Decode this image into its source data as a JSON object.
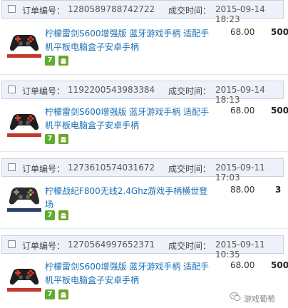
{
  "labels": {
    "order_no": "订单编号：",
    "deal_time": "成交时间："
  },
  "orders": [
    {
      "order_no": "1280589788742722",
      "time": "2015-09-14 18:23",
      "title": "柠檬雷剑S600增强版 蓝牙游戏手柄 适配手机平板电脑盒子安卓手柄",
      "price": "68.00",
      "qty": "500",
      "badge": "7"
    },
    {
      "order_no": "1192200543983384",
      "time": "2015-09-14 18:13",
      "title": "柠檬雷剑S600增强版 蓝牙游戏手柄 适配手机平板电脑盒子安卓手柄",
      "price": "68.00",
      "qty": "500",
      "badge": "7"
    },
    {
      "order_no": "1273610574031672",
      "time": "2015-09-11 17:03",
      "title": "柠檬战纪F800无线2.4Ghz游戏手柄横世登场",
      "price": "88.00",
      "qty": "3",
      "badge": "7"
    },
    {
      "order_no": "1270564997652371",
      "time": "2015-09-11 10:35",
      "title": "柠檬雷剑S600增强版 蓝牙游戏手柄 适配手机平板电脑盒子安卓手柄",
      "price": "68.00",
      "qty": "500",
      "badge": "7"
    }
  ],
  "watermark": "游戏葡萄",
  "colors": {
    "link": "#1a6fb3",
    "header_bg": "#eef2f8",
    "badge_green": "#5cae2e"
  }
}
